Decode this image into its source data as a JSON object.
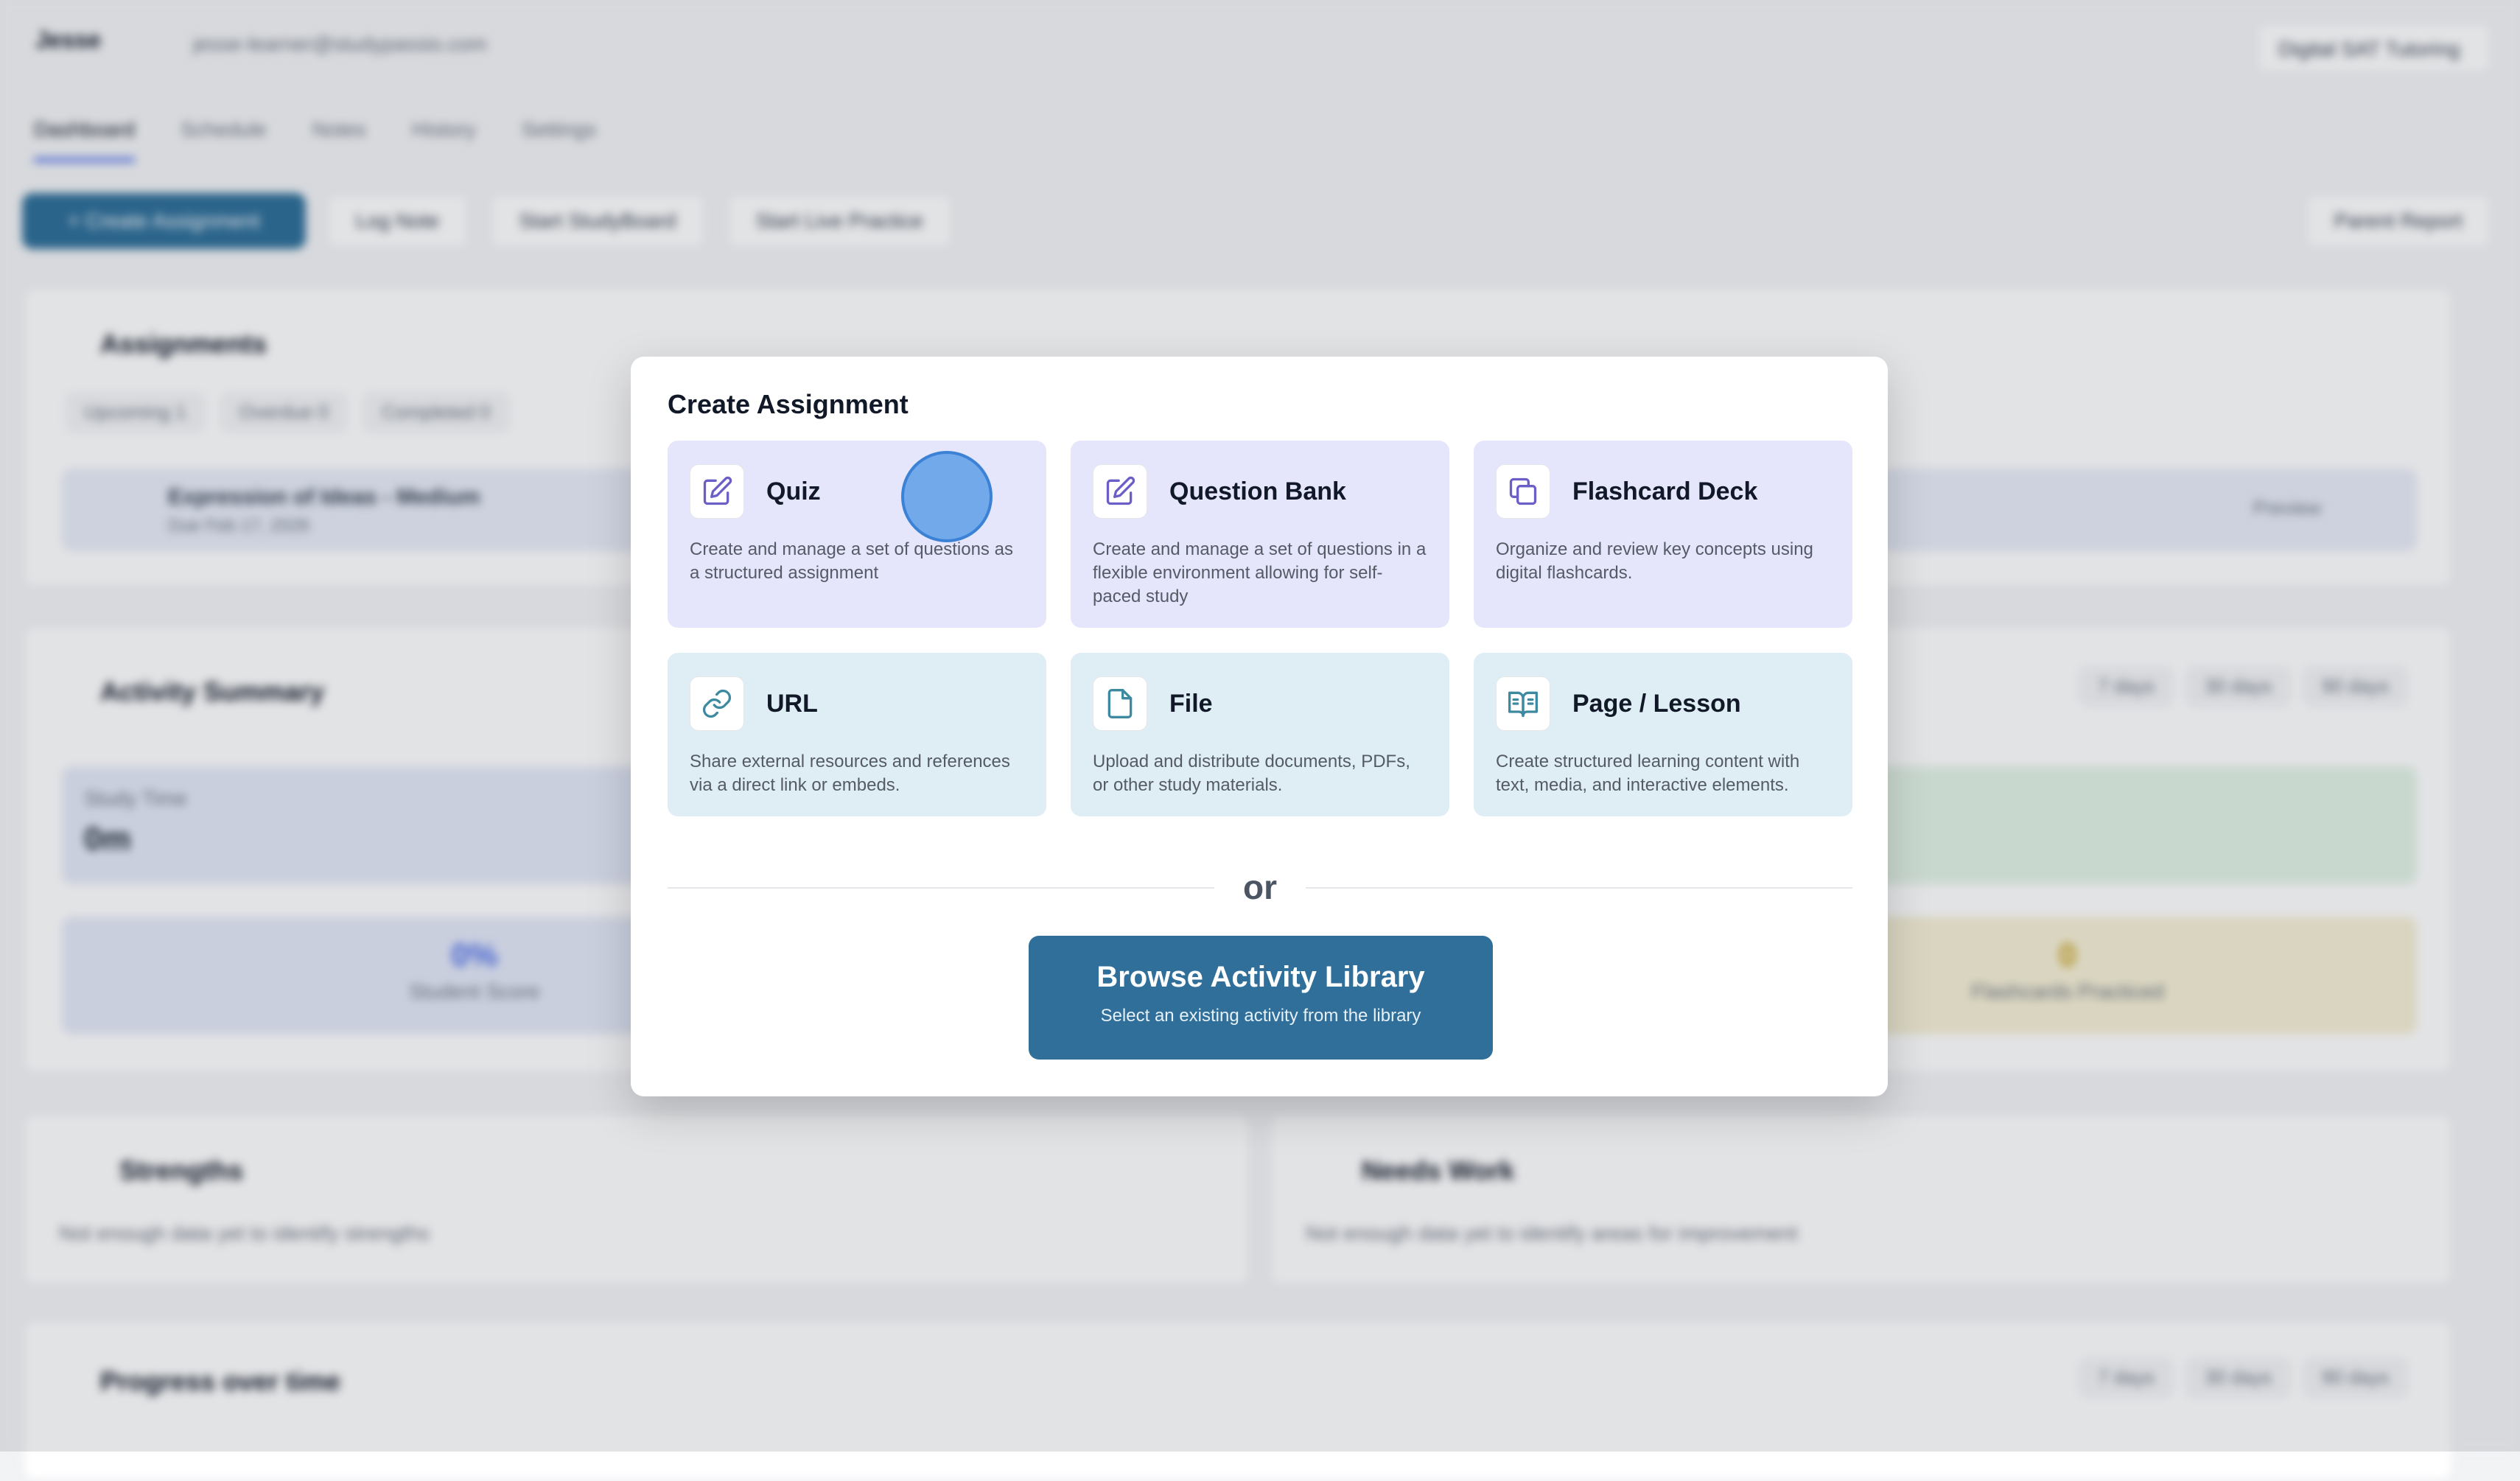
{
  "header": {
    "user_name": "Jesse",
    "email": "jesse-learner@studypassio.com",
    "program": "Digital SAT Tutoring"
  },
  "tabs": [
    "Dashboard",
    "Schedule",
    "Notes",
    "History",
    "Settings"
  ],
  "toolbar": {
    "create": "+ Create Assignment",
    "log_note": "Log Note",
    "start_studyboard": "Start StudyBoard",
    "start_live": "Start Live Practice",
    "parent_report": "Parent Report"
  },
  "assignments": {
    "title": "Assignments",
    "filters": [
      "Upcoming 1",
      "Overdue 0",
      "Completed 0"
    ],
    "item": {
      "title": "Expression of Ideas - Medium",
      "due": "Due Feb 17, 2026",
      "preview": "Preview"
    }
  },
  "activity": {
    "title": "Activity Summary",
    "ranges": [
      "7 days",
      "30 days",
      "90 days"
    ],
    "study_time_label": "Study Time",
    "study_time_value": "0m",
    "score_value": "0%",
    "score_label": "Student Score",
    "flash_value": "0",
    "flash_label": "Flashcards Practiced"
  },
  "strengths": {
    "title": "Strengths",
    "text": "Not enough data yet to identify strengths"
  },
  "needs_work": {
    "title": "Needs Work",
    "text": "Not enough data yet to identify areas for improvement"
  },
  "progress": {
    "title": "Progress over time",
    "ranges": [
      "7 days",
      "30 days",
      "90 days"
    ]
  },
  "modal": {
    "title": "Create Assignment",
    "options": [
      {
        "title": "Quiz",
        "desc": "Create and manage a set of questions as a structured assignment",
        "icon": "edit-icon"
      },
      {
        "title": "Question Bank",
        "desc": "Create and manage a set of questions in a flexible environment allowing for self-paced study",
        "icon": "edit-icon"
      },
      {
        "title": "Flashcard Deck",
        "desc": "Organize and review key concepts using digital flashcards.",
        "icon": "copy-icon"
      },
      {
        "title": "URL",
        "desc": "Share external resources and references via a direct link or embeds.",
        "icon": "link-icon"
      },
      {
        "title": "File",
        "desc": "Upload and distribute documents, PDFs, or other study materials.",
        "icon": "file-icon"
      },
      {
        "title": "Page / Lesson",
        "desc": "Create structured learning content with text, media, and interactive elements.",
        "icon": "book-open-icon"
      }
    ],
    "or": "or",
    "browse": {
      "title": "Browse Activity Library",
      "subtitle": "Select an existing activity from the library"
    }
  },
  "colors": {
    "primary": "#2f6f99",
    "purple_card": "#e5e6fb",
    "blue_card": "#dfeef5",
    "icon_purple": "#6b5fc7",
    "icon_teal": "#3d8aa0"
  }
}
